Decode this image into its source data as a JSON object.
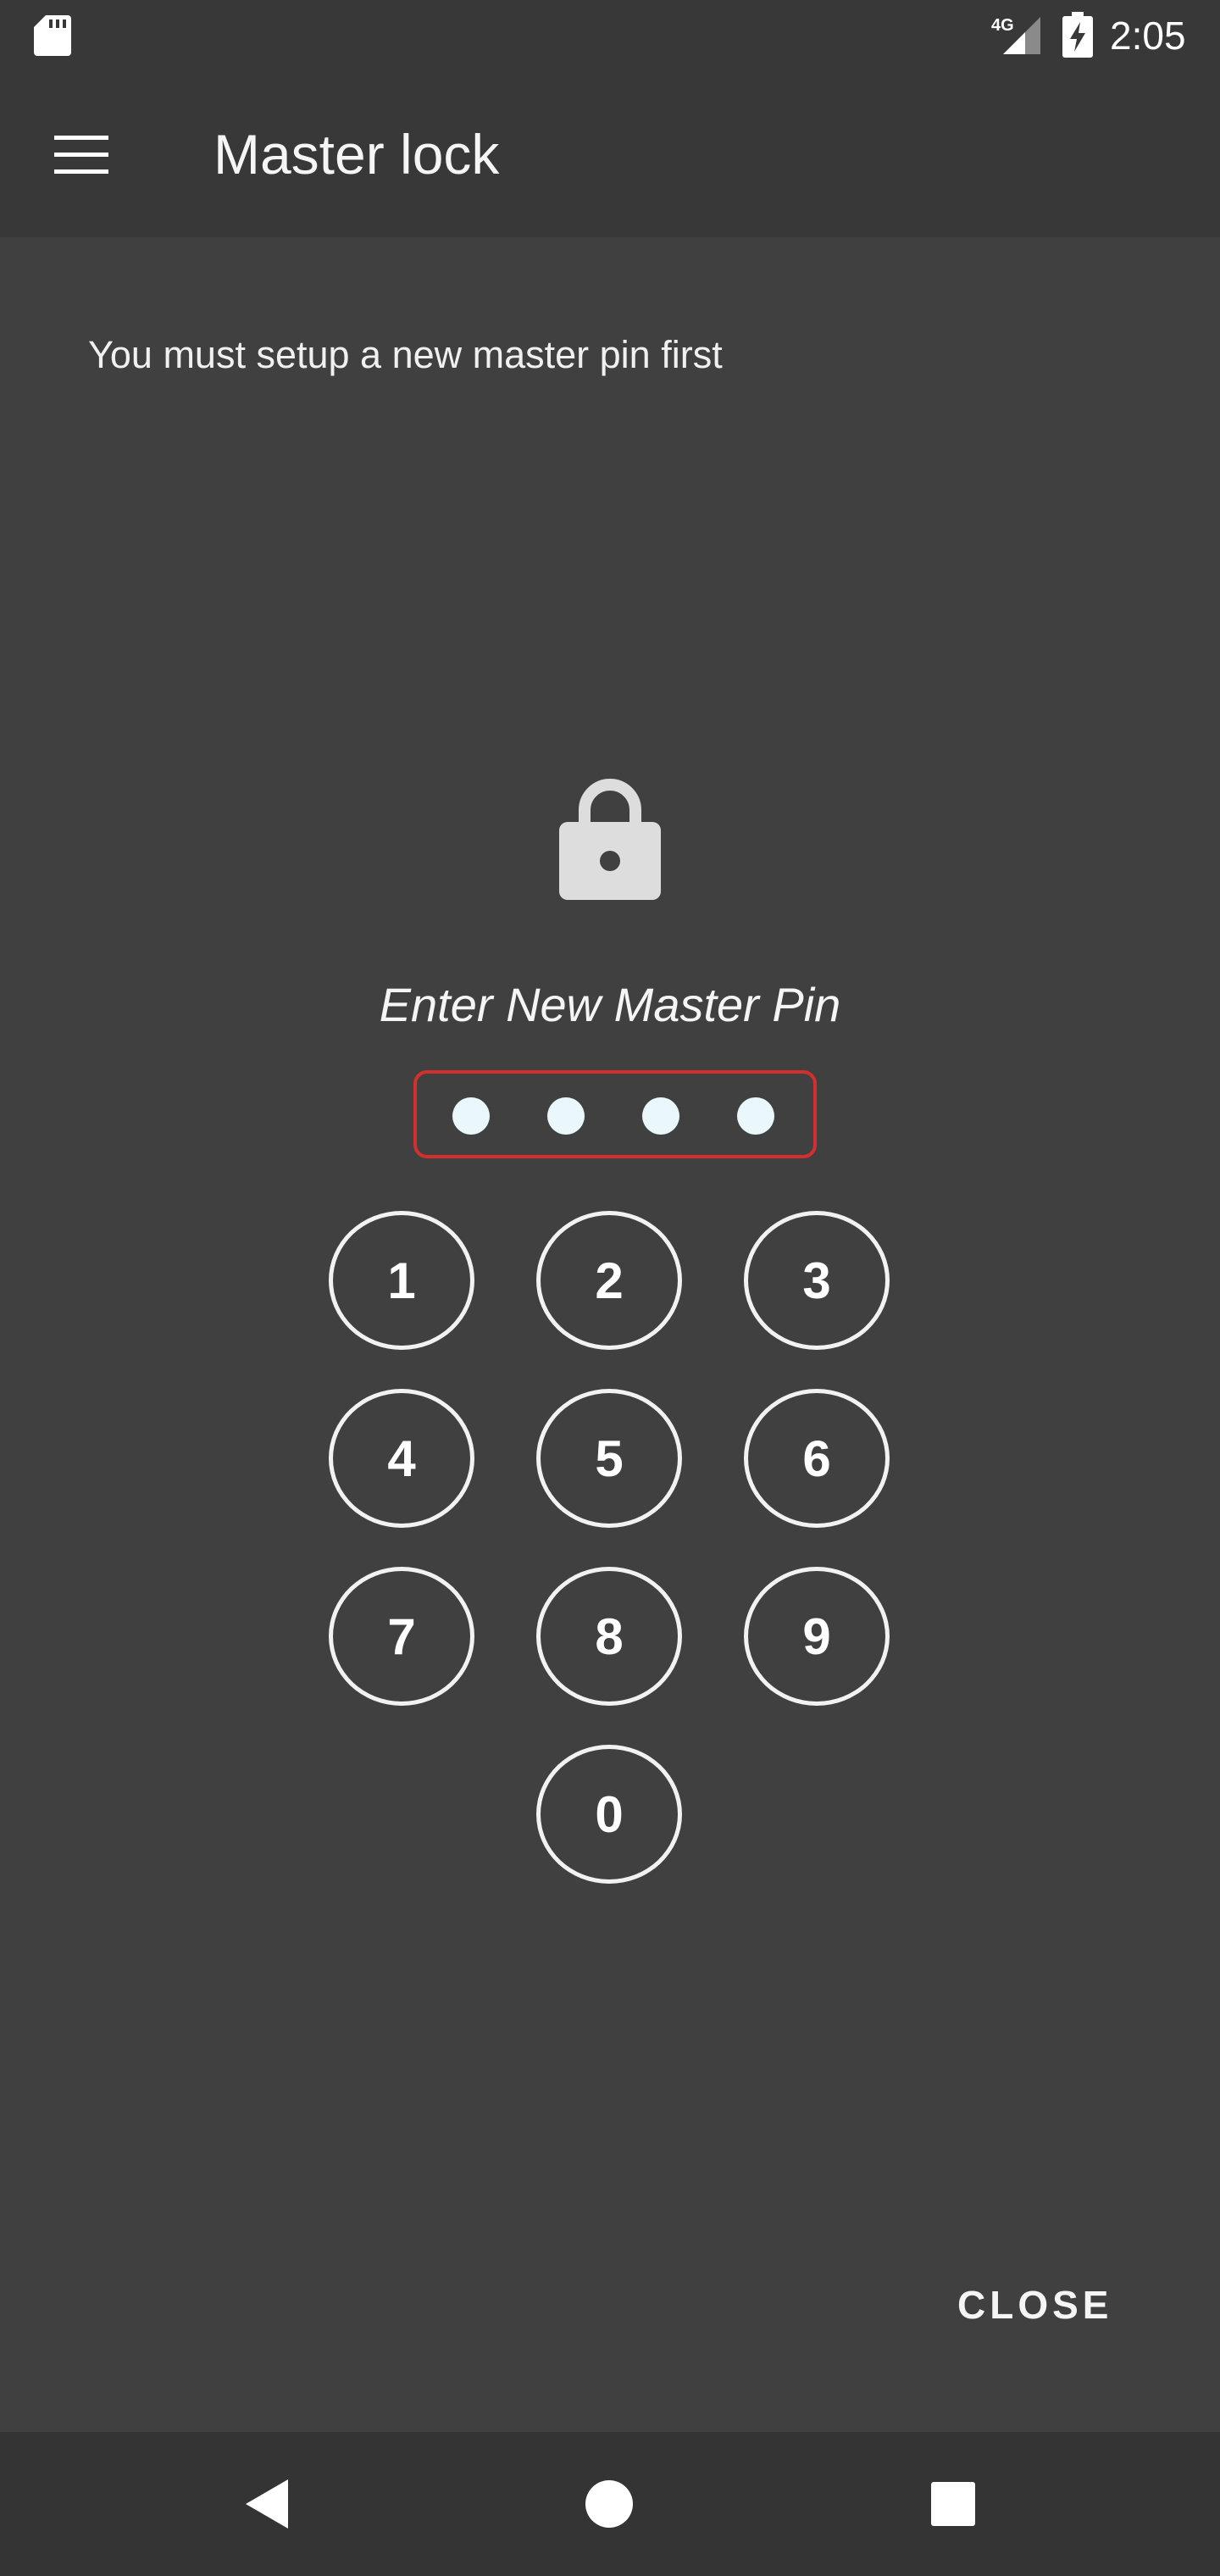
{
  "status_bar": {
    "time": "2:05",
    "network": "4G",
    "icons": [
      "sd-card-icon",
      "signal-icon",
      "battery-charging-icon"
    ]
  },
  "app_bar": {
    "title": "Master lock",
    "menu_icon": "menu-icon"
  },
  "content": {
    "notice": "You must setup a new master pin first",
    "lock_icon": "lock-icon",
    "prompt": "Enter New Master Pin",
    "pin_length": 4,
    "keys": [
      "1",
      "2",
      "3",
      "4",
      "5",
      "6",
      "7",
      "8",
      "9",
      "0"
    ],
    "close_label": "CLOSE"
  },
  "colors": {
    "background": "#404040",
    "bars": "#383838",
    "pin_border": "#d32f2f",
    "pin_dot": "#eaf8fb"
  },
  "nav_bar": {
    "icons": [
      "back-icon",
      "home-icon",
      "recents-icon"
    ]
  }
}
